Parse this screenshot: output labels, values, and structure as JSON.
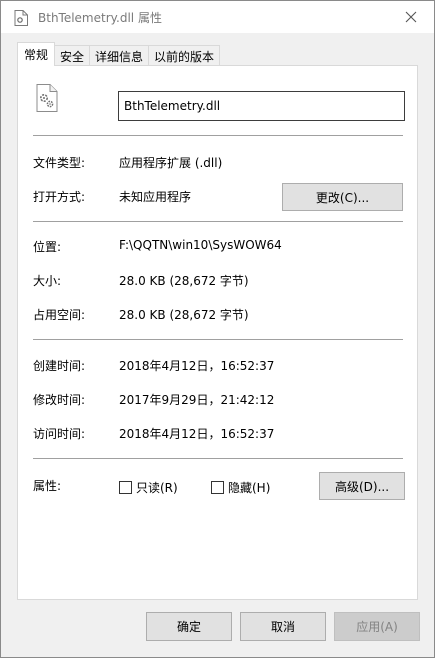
{
  "window": {
    "title": "BthTelemetry.dll 属性"
  },
  "tabs": [
    {
      "label": "常规",
      "active": true
    },
    {
      "label": "安全",
      "active": false
    },
    {
      "label": "详细信息",
      "active": false
    },
    {
      "label": "以前的版本",
      "active": false
    }
  ],
  "general": {
    "file_name": "BthTelemetry.dll",
    "file_type_label": "文件类型:",
    "file_type_value": "应用程序扩展 (.dll)",
    "opens_with_label": "打开方式:",
    "opens_with_value": "未知应用程序",
    "change_button": "更改(C)...",
    "location_label": "位置:",
    "location_value": "F:\\QQTN\\win10\\SysWOW64",
    "size_label": "大小:",
    "size_value": "28.0 KB (28,672 字节)",
    "size_on_disk_label": "占用空间:",
    "size_on_disk_value": "28.0 KB (28,672 字节)",
    "created_label": "创建时间:",
    "created_value": "2018年4月12日，16:52:37",
    "modified_label": "修改时间:",
    "modified_value": "2017年9月29日，21:42:12",
    "accessed_label": "访问时间:",
    "accessed_value": "2018年4月12日，16:52:37",
    "attributes_label": "属性:",
    "readonly_label": "只读(R)",
    "hidden_label": "隐藏(H)",
    "advanced_button": "高级(D)..."
  },
  "footer": {
    "ok_button": "确定",
    "cancel_button": "取消",
    "apply_button": "应用(A)"
  },
  "colors": {
    "panel_bg": "#ffffff",
    "dialog_bg": "#f0f0f0",
    "button_bg": "#e1e1e1",
    "button_border": "#adadad",
    "disabled_text": "#838383"
  }
}
